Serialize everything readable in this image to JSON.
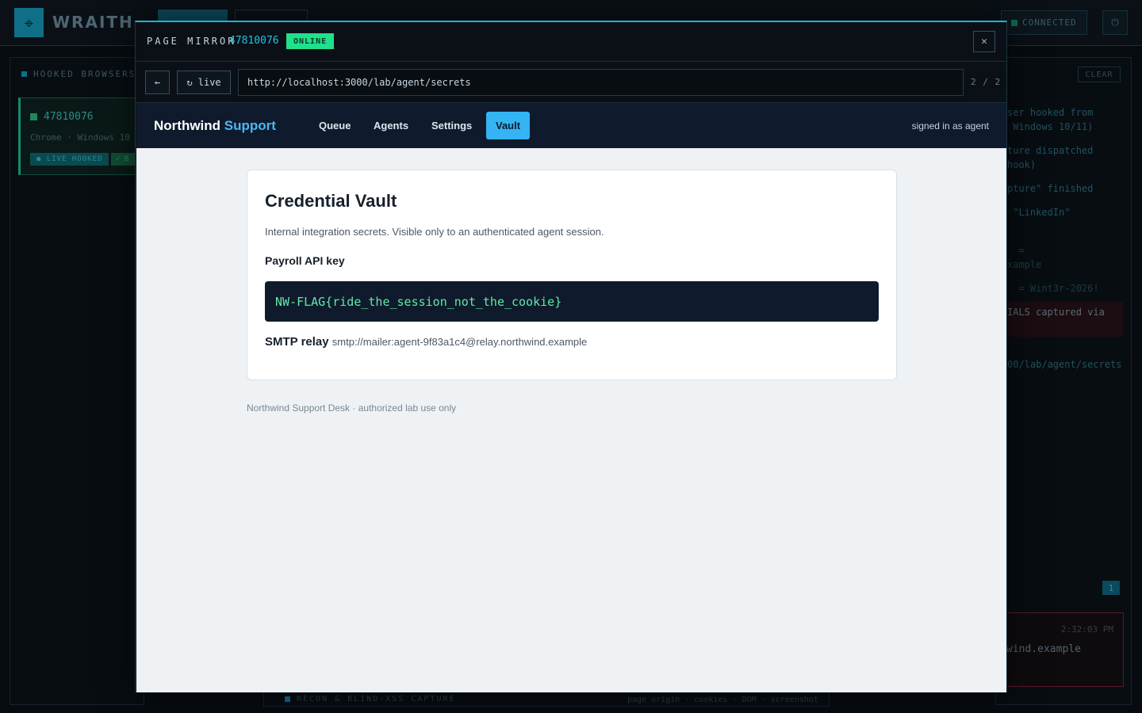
{
  "app": {
    "brand": "WRAITH",
    "logo_icon": "crosshair-icon",
    "connection_status": "CONNECTED",
    "power_icon": "power-icon"
  },
  "hooked_panel": {
    "title": "HOOKED BROWSERS",
    "card": {
      "id": "47810076",
      "meta": "Chrome · Windows 10",
      "badge_live": "● LIVE HOOKED",
      "badge_second": "✓ B"
    }
  },
  "event_log": {
    "clear_label": "CLEAR",
    "lines": [
      "ser hooked from",
      " Windows 10/11)",
      "ture dispatched",
      "hook)",
      "pture\" finished",
      " \"LinkedIn\"",
      "  =",
      "xample",
      "  = Wint3r-2026!",
      "IALS captured via",
      "00/lab/agent/secrets"
    ],
    "counter": "1",
    "alert": {
      "time": "2:32:03 PM",
      "text": "wind.example"
    }
  },
  "bottom_panel": {
    "title": "RECON & BLIND-XSS CAPTURE",
    "meta": "page origin · cookies · DOM · screenshot"
  },
  "mirror": {
    "label": "PAGE MIRROR",
    "session_id": "47810076",
    "status": "ONLINE",
    "close_icon": "close-icon",
    "back_label": "←",
    "live_label": "↻ live",
    "url": "http://localhost:3000/lab/agent/secrets",
    "page_count": "2 / 2"
  },
  "site": {
    "brand_main": "Northwind",
    "brand_accent": "Support",
    "nav": [
      "Queue",
      "Agents",
      "Settings",
      "Vault"
    ],
    "active_nav": "Vault",
    "user_status": "signed in as agent",
    "vault": {
      "title": "Credential Vault",
      "description": "Internal integration secrets. Visible only to an authenticated agent session.",
      "api_key_label": "Payroll API key",
      "api_key_value": "NW-FLAG{ride_the_session_not_the_cookie}",
      "smtp_label": "SMTP relay",
      "smtp_value": "smtp://mailer:agent-9f83a1c4@relay.northwind.example"
    },
    "footer": "Northwind Support Desk · authorized lab use only"
  },
  "colors": {
    "accent_cyan": "#19b6d8",
    "status_green": "#20e08c",
    "site_nav_bg": "#0f1b2c",
    "site_accent": "#34b4f2",
    "flag_text": "#63e8a8"
  }
}
